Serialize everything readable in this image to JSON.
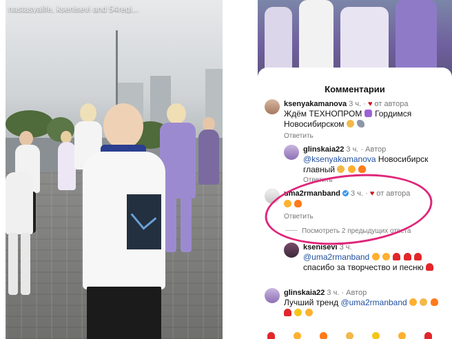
{
  "story": {
    "viewers_text": "nastasyalife, ksenisevi and 54regi..."
  },
  "comments_panel": {
    "title": "Комментарии",
    "reply_label": "Ответить",
    "see_previous": "Посмотреть 2 предыдущих ответа",
    "comments": [
      {
        "username": "ksenyakamanova",
        "time": "3 ч.",
        "badge": "от автора",
        "text_line1": "Ждём ТЕХНОПРОМ",
        "text_line1b": "Гордимся",
        "text_line2": "Новосибирском"
      },
      {
        "username": "glinskaia22",
        "time": "3 ч.",
        "badge": "Автор",
        "mention": "@ksenyakamanova",
        "text_line1": "Новосибирск",
        "text_line2": "главный"
      },
      {
        "username": "uma2rmanband",
        "time": "3 ч.",
        "badge": "от автора"
      },
      {
        "username": "ksenisevi",
        "time": "3 ч.",
        "mention": "@uma2rmanband",
        "text_line2": "спасибо за творчество и песню"
      },
      {
        "username": "glinskaia22",
        "time": "3 ч.",
        "badge": "Автор",
        "text_prefix": "Лучший тренд",
        "mention": "@uma2rmanband"
      }
    ]
  },
  "colors": {
    "highlight_ring": "#e0267a",
    "mention": "#1f4fa0",
    "heart": "#d0161b",
    "verified": "#3897f0"
  }
}
